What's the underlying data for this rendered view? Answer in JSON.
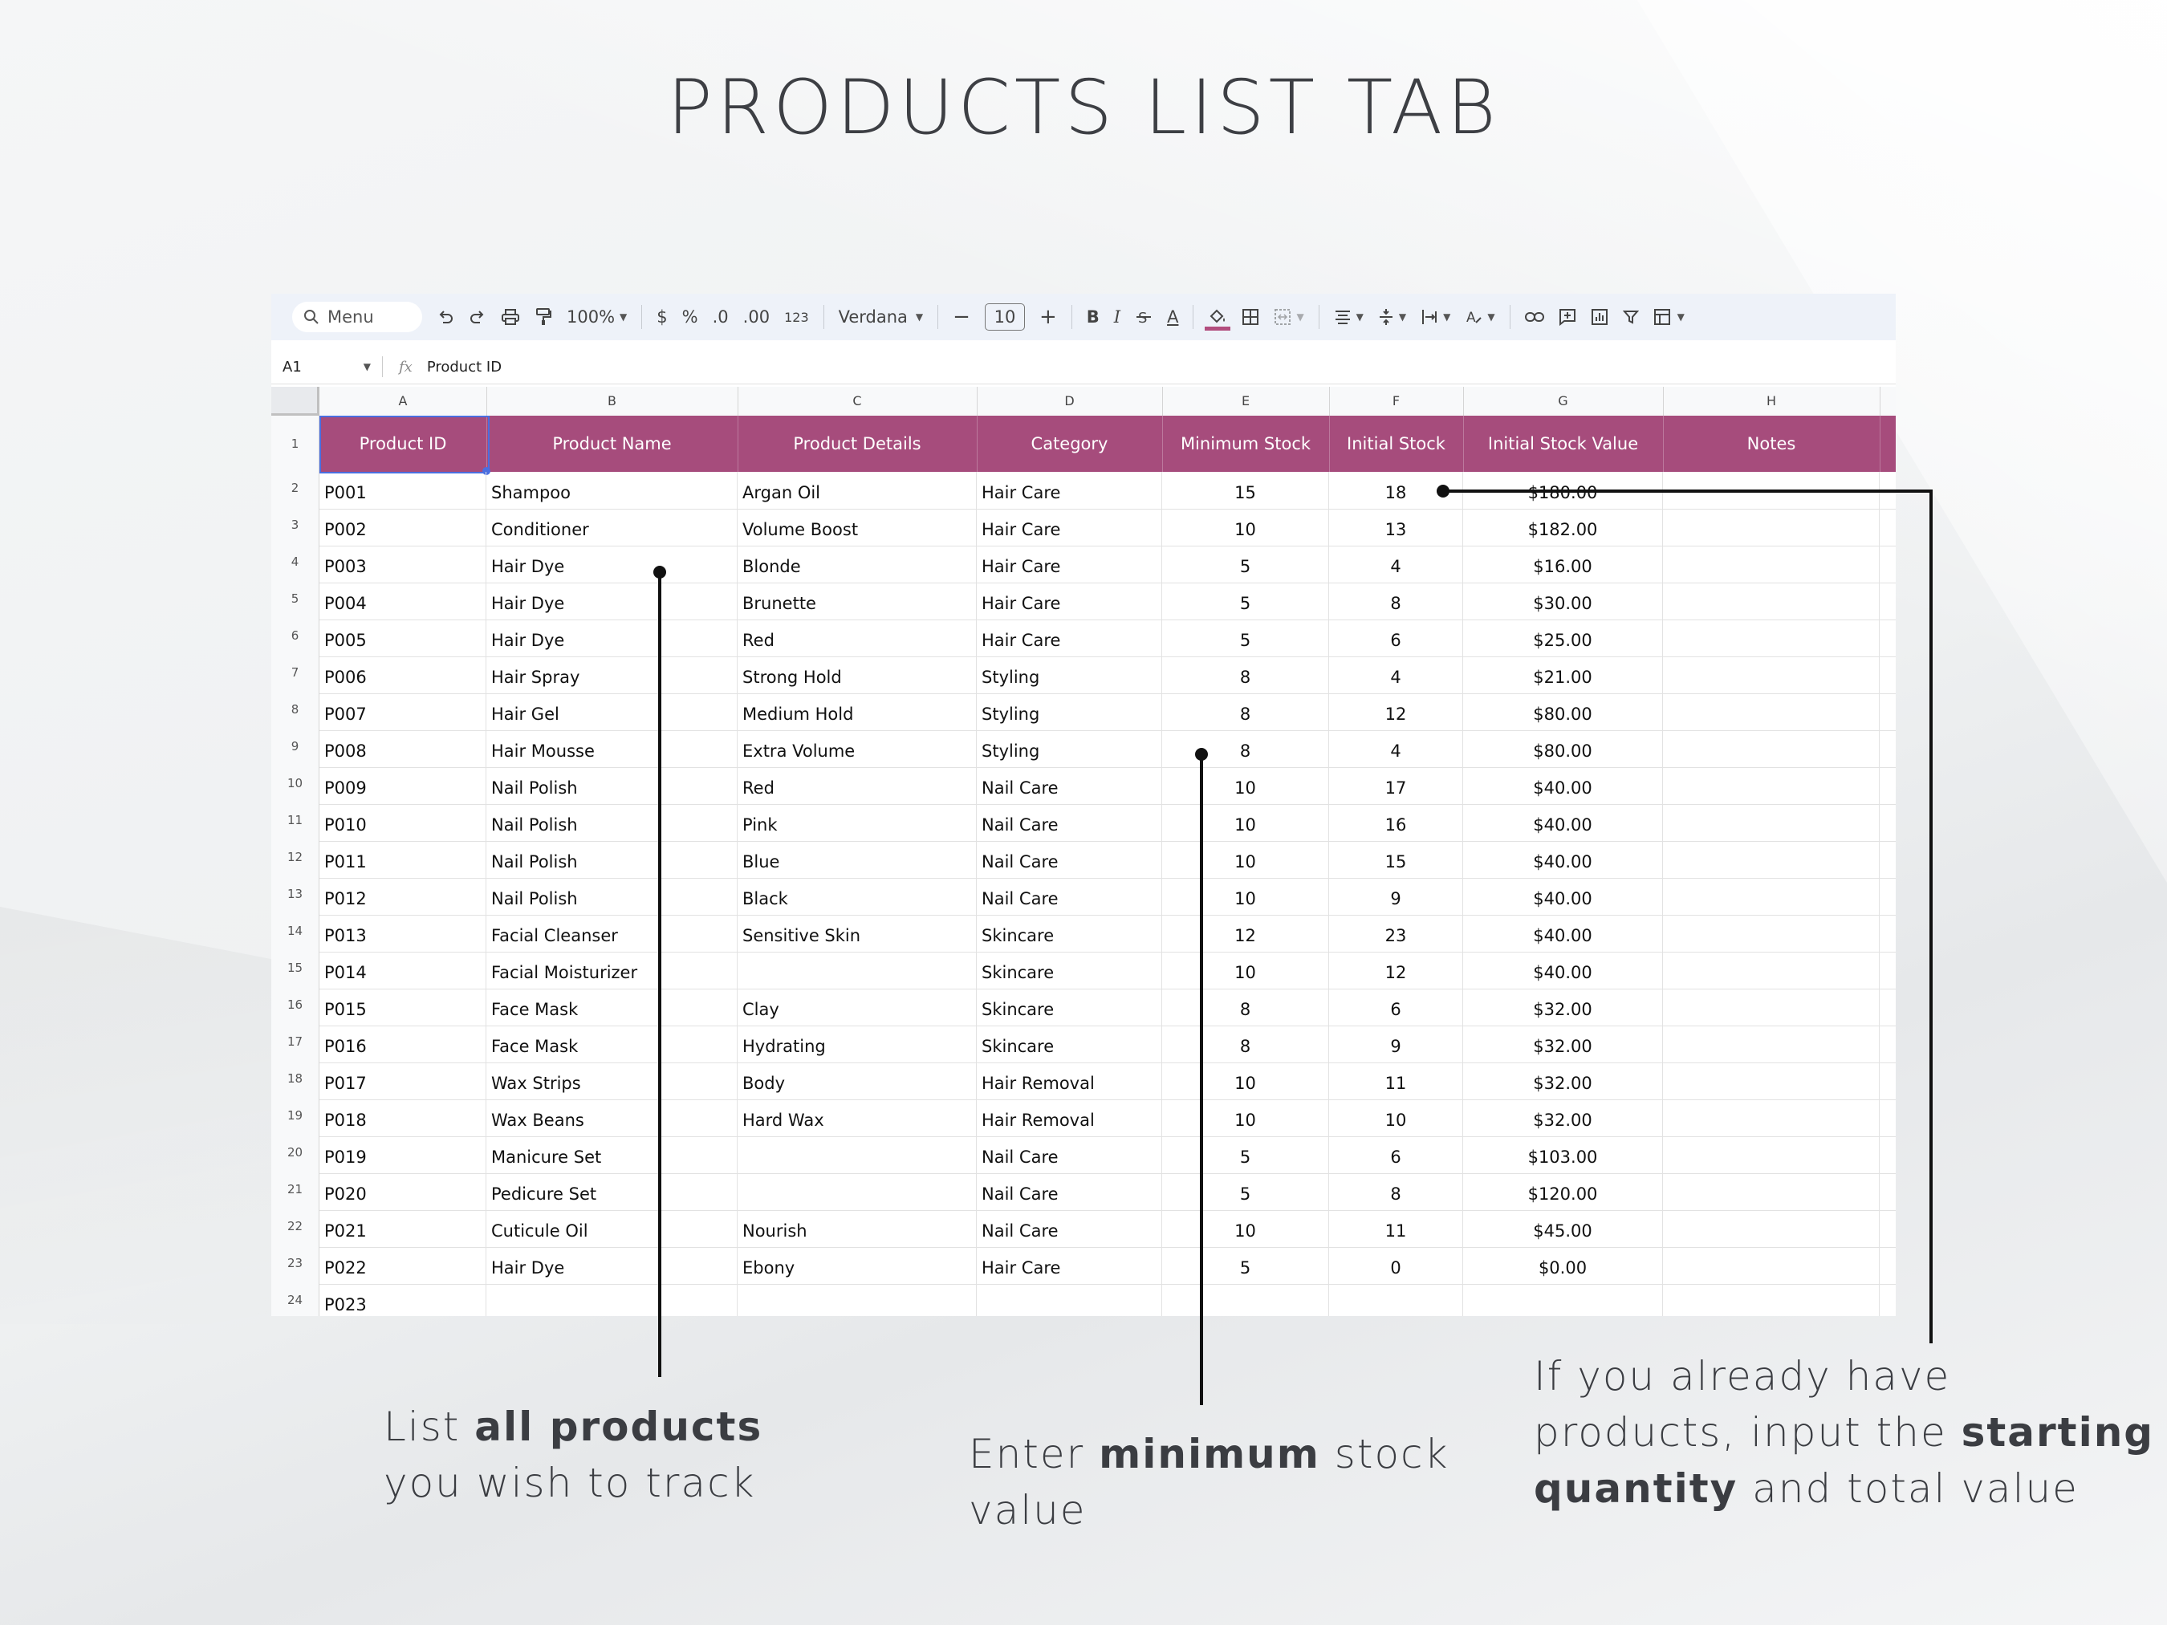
{
  "page_title": "PRODUCTS LIST TAB",
  "toolbar": {
    "menu_label": "Menu",
    "zoom": "100%",
    "currency": "$",
    "percent": "%",
    "dec_decrease": ".0",
    "dec_increase": ".00",
    "number_format": "123",
    "font": "Verdana",
    "font_size": "10",
    "bold": "B",
    "italic": "I",
    "text_color": "A"
  },
  "formula_bar": {
    "cell_ref": "A1",
    "fx": "fx",
    "value": "Product ID"
  },
  "columns": [
    "A",
    "B",
    "C",
    "D",
    "E",
    "F",
    "G",
    "H"
  ],
  "headers": [
    "Product ID",
    "Product Name",
    "Product Details",
    "Category",
    "Minimum Stock",
    "Initial Stock",
    "Initial Stock Value",
    "Notes"
  ],
  "row_numbers": [
    "1",
    "2",
    "3",
    "4",
    "5",
    "6",
    "7",
    "8",
    "9",
    "10",
    "11",
    "12",
    "13",
    "14",
    "15",
    "16",
    "17",
    "18",
    "19",
    "20",
    "21",
    "22",
    "23",
    "24"
  ],
  "rows": [
    [
      "P001",
      "Shampoo",
      "Argan Oil",
      "Hair Care",
      "15",
      "18",
      "$180.00",
      ""
    ],
    [
      "P002",
      "Conditioner",
      "Volume Boost",
      "Hair Care",
      "10",
      "13",
      "$182.00",
      ""
    ],
    [
      "P003",
      "Hair Dye",
      "Blonde",
      "Hair Care",
      "5",
      "4",
      "$16.00",
      ""
    ],
    [
      "P004",
      "Hair Dye",
      "Brunette",
      "Hair Care",
      "5",
      "8",
      "$30.00",
      ""
    ],
    [
      "P005",
      "Hair Dye",
      "Red",
      "Hair Care",
      "5",
      "6",
      "$25.00",
      ""
    ],
    [
      "P006",
      "Hair Spray",
      "Strong Hold",
      "Styling",
      "8",
      "4",
      "$21.00",
      ""
    ],
    [
      "P007",
      "Hair Gel",
      "Medium Hold",
      "Styling",
      "8",
      "12",
      "$80.00",
      ""
    ],
    [
      "P008",
      "Hair Mousse",
      "Extra Volume",
      "Styling",
      "8",
      "4",
      "$80.00",
      ""
    ],
    [
      "P009",
      "Nail Polish",
      "Red",
      "Nail Care",
      "10",
      "17",
      "$40.00",
      ""
    ],
    [
      "P010",
      "Nail Polish",
      "Pink",
      "Nail Care",
      "10",
      "16",
      "$40.00",
      ""
    ],
    [
      "P011",
      "Nail Polish",
      "Blue",
      "Nail Care",
      "10",
      "15",
      "$40.00",
      ""
    ],
    [
      "P012",
      "Nail Polish",
      "Black",
      "Nail Care",
      "10",
      "9",
      "$40.00",
      ""
    ],
    [
      "P013",
      "Facial Cleanser",
      "Sensitive Skin",
      "Skincare",
      "12",
      "23",
      "$40.00",
      ""
    ],
    [
      "P014",
      "Facial Moisturizer",
      "",
      "Skincare",
      "10",
      "12",
      "$40.00",
      ""
    ],
    [
      "P015",
      "Face Mask",
      "Clay",
      "Skincare",
      "8",
      "6",
      "$32.00",
      ""
    ],
    [
      "P016",
      "Face Mask",
      "Hydrating",
      "Skincare",
      "8",
      "9",
      "$32.00",
      ""
    ],
    [
      "P017",
      "Wax Strips",
      "Body",
      "Hair Removal",
      "10",
      "11",
      "$32.00",
      ""
    ],
    [
      "P018",
      "Wax Beans",
      "Hard Wax",
      "Hair Removal",
      "10",
      "10",
      "$32.00",
      ""
    ],
    [
      "P019",
      "Manicure Set",
      "",
      "Nail Care",
      "5",
      "6",
      "$103.00",
      ""
    ],
    [
      "P020",
      "Pedicure Set",
      "",
      "Nail Care",
      "5",
      "8",
      "$120.00",
      ""
    ],
    [
      "P021",
      "Cuticule Oil",
      "Nourish",
      "Nail Care",
      "10",
      "11",
      "$45.00",
      ""
    ],
    [
      "P022",
      "Hair Dye",
      "Ebony",
      "Hair Care",
      "5",
      "0",
      "$0.00",
      ""
    ],
    [
      "P023",
      "",
      "",
      "",
      "",
      "",
      "",
      ""
    ]
  ],
  "captions": {
    "products": {
      "pre": "List ",
      "bold": "all products",
      "post": "you wish to track"
    },
    "minimum": {
      "pre": "Enter ",
      "bold": "minimum",
      "post1": " stock",
      "post2": "value"
    },
    "starting": {
      "line1": "If you already have",
      "pre2": "products, input the ",
      "bold2": "starting",
      "bold3": "quantity",
      "post3": " and total value"
    }
  },
  "colors": {
    "header_bg": "#a64c7c",
    "selection": "#4a6ee0",
    "fill_indicator": "#b24d7e"
  }
}
